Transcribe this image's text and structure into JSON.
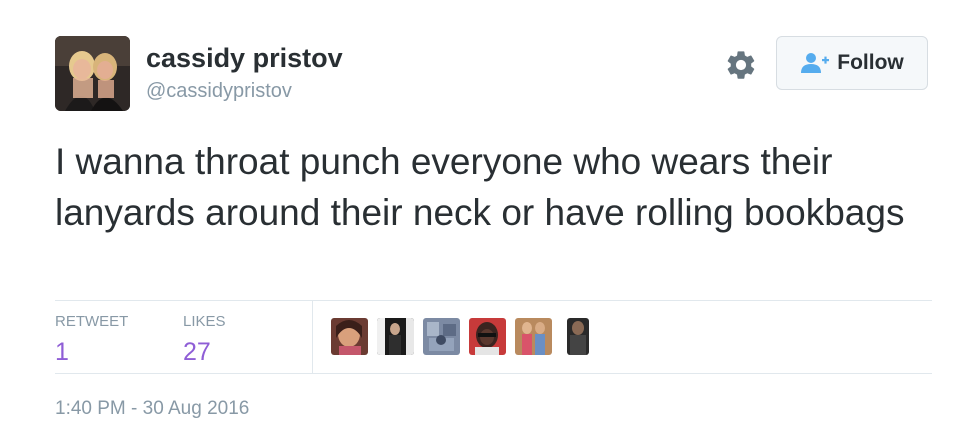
{
  "user": {
    "display_name": "cassidy pristov",
    "handle": "@cassidypristov"
  },
  "actions": {
    "settings_icon": "gear-icon",
    "follow_icon": "add-user-icon",
    "follow_label": "Follow",
    "accent_color": "#55acee"
  },
  "tweet": {
    "text": "I wanna throat punch everyone who wears their lanyards around their neck or have rolling bookbags",
    "timestamp": "1:40 PM - 30 Aug 2016"
  },
  "stats": {
    "retweet_label": "RETWEET",
    "retweet_count": "1",
    "likes_label": "LIKES",
    "likes_count": "27",
    "count_color": "#8f5ed6"
  },
  "liked_by": {
    "avatar_count": 6
  }
}
